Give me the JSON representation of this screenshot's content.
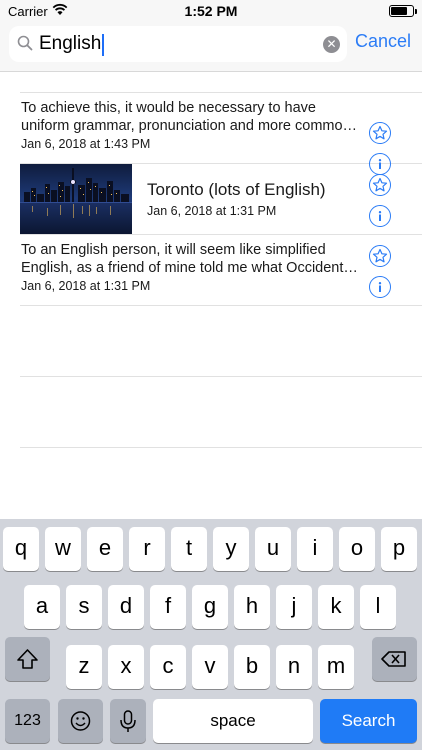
{
  "status_bar": {
    "carrier": "Carrier",
    "time": "1:52 PM",
    "battery_level": 0.75
  },
  "search": {
    "value": "English",
    "cancel_label": "Cancel"
  },
  "results": [
    {
      "type": "text",
      "line1": "To achieve this, it would be necessary to have",
      "line2": "uniform grammar, pronunciation and more commo…",
      "date": "Jan 6, 2018 at 1:43 PM"
    },
    {
      "type": "image",
      "title": "Toronto (lots of English)",
      "date": "Jan 6, 2018 at 1:31 PM"
    },
    {
      "type": "text",
      "line1": "To an English person, it will seem like simplified",
      "line2": "English, as a friend of mine told me what Occident…",
      "date": "Jan 6, 2018 at 1:31 PM"
    }
  ],
  "keyboard": {
    "row1": [
      "q",
      "w",
      "e",
      "r",
      "t",
      "y",
      "u",
      "i",
      "o",
      "p"
    ],
    "row2": [
      "a",
      "s",
      "d",
      "f",
      "g",
      "h",
      "j",
      "k",
      "l"
    ],
    "row3": [
      "z",
      "x",
      "c",
      "v",
      "b",
      "n",
      "m"
    ],
    "numbers_label": "123",
    "space_label": "space",
    "search_label": "Search"
  },
  "colors": {
    "accent": "#2b7cf6",
    "search_key": "#1f7bf6",
    "keyboard_bg": "#d1d4db"
  },
  "icons": [
    "wifi-icon",
    "search-icon",
    "clear-icon",
    "star-icon",
    "info-icon",
    "shift-icon",
    "delete-icon",
    "emoji-icon",
    "mic-icon"
  ]
}
